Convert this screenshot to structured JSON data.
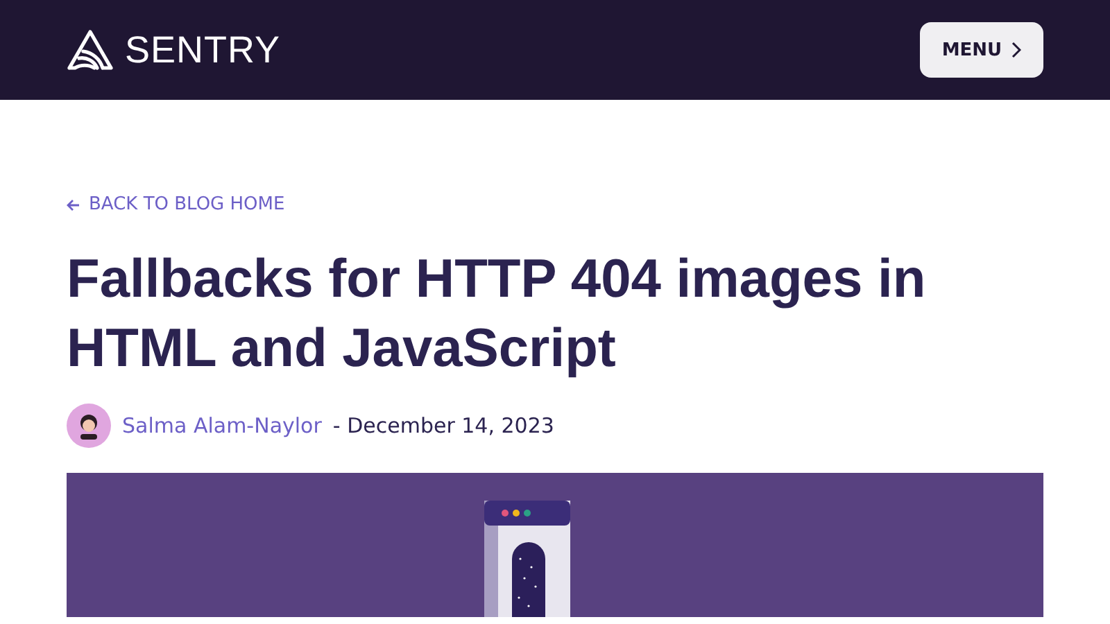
{
  "header": {
    "brand": "SENTRY",
    "menu_button": "MENU"
  },
  "back_link": "BACK TO BLOG HOME",
  "title": "Fallbacks for HTTP 404 images in HTML and JavaScript",
  "byline": {
    "author": "Salma Alam-Naylor",
    "date": "- December 14, 2023"
  }
}
